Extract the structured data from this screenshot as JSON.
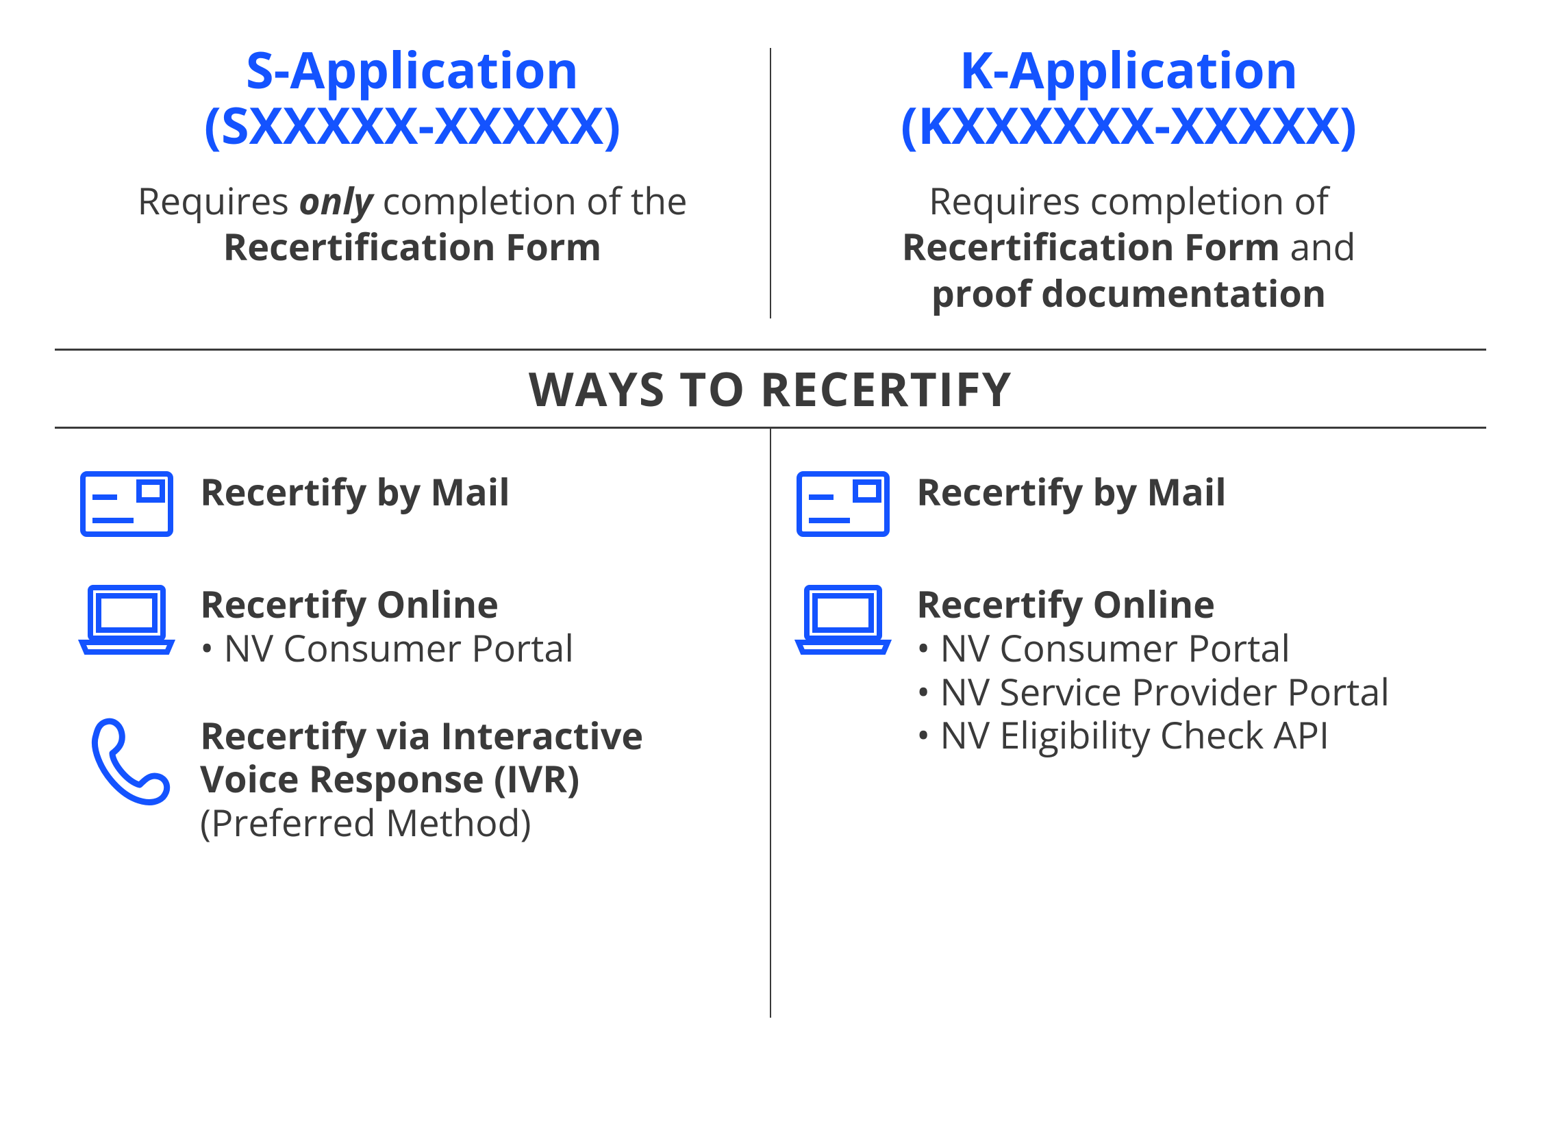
{
  "colors": {
    "accent": "#1453ff",
    "text": "#3a3a3a"
  },
  "top": {
    "left": {
      "title_line1": "S-Application",
      "title_line2": "(SXXXXX-XXXXX)",
      "desc_pre": "Requires ",
      "desc_only": "only",
      "desc_mid": " completion of the ",
      "desc_bold": "Recertification Form"
    },
    "right": {
      "title_line1": "K-Application",
      "title_line2": "(KXXXXXX-XXXXX)",
      "desc_pre": "Requires completion of ",
      "desc_bold1": "Recertification Form",
      "desc_mid": " and ",
      "desc_bold2": "proof documentation"
    }
  },
  "section_title": "WAYS TO RECERTIFY",
  "bottom": {
    "left": {
      "mail": {
        "title": "Recertify by Mail"
      },
      "online": {
        "title": "Recertify Online",
        "sub1": "• NV Consumer Portal"
      },
      "ivr": {
        "title_l1": "Recertify via Interactive",
        "title_l2": "Voice Response (IVR)",
        "sub": "(Preferred Method)"
      }
    },
    "right": {
      "mail": {
        "title": "Recertify by Mail"
      },
      "online": {
        "title": "Recertify Online",
        "sub1": "• NV Consumer Portal",
        "sub2": "• NV Service Provider Portal",
        "sub3": "• NV Eligibility Check API"
      }
    }
  }
}
